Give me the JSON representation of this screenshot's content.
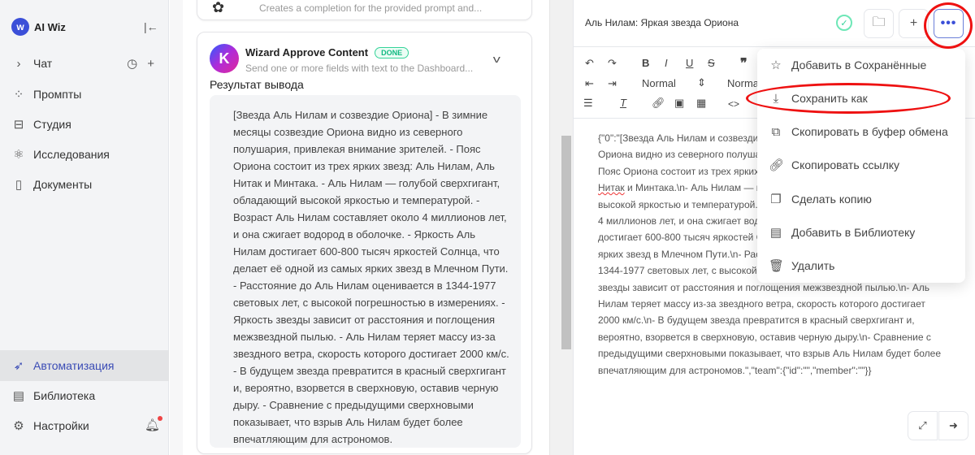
{
  "sidebar": {
    "brand": "AI Wiz",
    "items": [
      {
        "label": "Чат",
        "icon": "chevron-right-icon"
      },
      {
        "label": "Промпты",
        "icon": "grid-icon"
      },
      {
        "label": "Студия",
        "icon": "paint-roller-icon"
      },
      {
        "label": "Исследования",
        "icon": "atom-icon"
      },
      {
        "label": "Документы",
        "icon": "document-icon"
      },
      {
        "label": "Автоматизация",
        "icon": "rocket-icon",
        "active": true
      },
      {
        "label": "Библиотека",
        "icon": "book-icon"
      },
      {
        "label": "Настройки",
        "icon": "gear-icon"
      }
    ],
    "accent": "#3a4bb5"
  },
  "workflow": {
    "prev_card": {
      "description": "Creates a completion for the provided prompt and..."
    },
    "card": {
      "title": "Wizard Approve Content",
      "status": "DONE",
      "description": "Send one or more fields with text to the Dashboard...",
      "result_label": "Результат вывода",
      "output": "[Звезда Аль Нилам и созвездие Ориона] - В зимние месяцы созвездие Ориона видно из северного полушария, привлекая внимание зрителей. - Пояс Ориона состоит из трех ярких звезд: Аль Нилам, Аль Нитак и Минтака. - Аль Нилам — голубой сверхгигант, обладающий высокой яркостью и температурой. - Возраст Аль Нилам составляет около 4 миллионов лет, и она сжигает водород в оболочке. - Яркость Аль Нилам достигает 600-800 тысяч яркостей Солнца, что делает её одной из самых ярких звезд в Млечном Пути. - Расстояние до Аль Нилам оценивается в 1344-1977 световых лет, с высокой погрешностью в измерениях. - Яркость звезды зависит от расстояния и поглощения межзвездной пылью. - Аль Нилам теряет массу из-за звездного ветра, скорость которого достигает 2000 км/с. - В будущем звезда превратится в красный сверхгигант и, вероятно, взорвется в сверхновую, оставив черную дыру. - Сравнение с предыдущими сверхновыми показывает, что взрыв Аль Нилам будет более впечатляющим для астрономов."
    }
  },
  "document": {
    "title": "Аль Нилам: Яркая звезда Ориона",
    "toolbar": {
      "heading_select": "Normal",
      "size_select": "Normal",
      "code": "<>"
    },
    "content_a": "{\"0\":\"[Звезда Аль Нилам и созвездие Ориона] - В зимние месяцы созвездие Ориона видно из северного полушария, привлекая внимание зрителей.\\n- Пояс Ориона состоит из трех ярких звезд: Аль Нилам, Аль ",
    "content_squig": "Нитак",
    "content_b": " и Минтака.\\n- Аль Нилам — голубой сверхгигант, обладающий высокой яркостью и температурой.\\n- Возраст Аль Нилам составляет около 4 миллионов лет, и она сжигает водород в оболочке.\\n- Яркость Аль Нилам достигает 600-800 тысяч яркостей Солнца, что делает её одной из самых ярких звезд в Млечном Пути.\\n- Расстояние до Аль Нилам оценивается в 1344-1977 световых лет, с высокой погрешностью в измерениях.\\n- Яркость звезды зависит от расстояния и поглощения межзвездной пылью.\\n- Аль Нилам теряет массу из-за звездного ветра, скорость которого достигает 2000 км/с.\\n- В будущем звезда превратится в красный сверхгигант и, вероятно, взорвется в сверхновую, оставив черную дыру.\\n- Сравнение с предыдущими сверхновыми показывает, что взрыв Аль Нилам будет более впечатляющим для астрономов.\",\"team\":{\"id\":\"\",\"member\":\"\"}}"
  },
  "menu": {
    "items": [
      {
        "label": "Добавить в Сохранённые",
        "icon": "star-icon"
      },
      {
        "label": "Сохранить как",
        "icon": "download-icon",
        "highlighted": true
      },
      {
        "label": "Скопировать в буфер обмена",
        "icon": "copy-icon"
      },
      {
        "label": "Скопировать ссылку",
        "icon": "link-icon"
      },
      {
        "label": "Сделать копию",
        "icon": "duplicate-icon"
      },
      {
        "label": "Добавить в Библиотеку",
        "icon": "library-icon"
      },
      {
        "label": "Удалить",
        "icon": "trash-icon"
      }
    ]
  },
  "annotation_color": "#ee1111"
}
